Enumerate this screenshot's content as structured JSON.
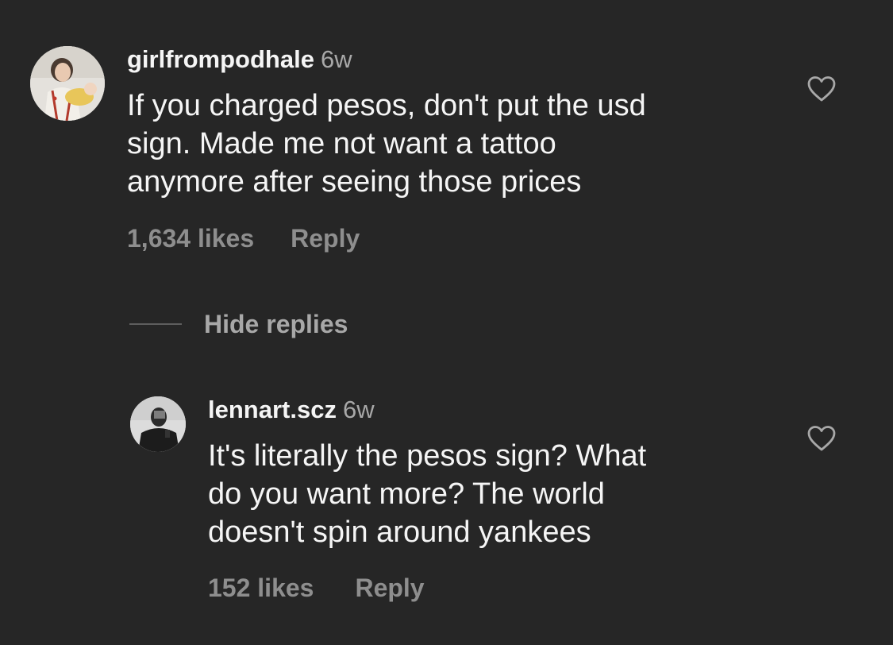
{
  "comments": [
    {
      "username": "girlfrompodhale",
      "time": "6w",
      "text": "If you charged pesos, don't put the usd\nsign.  Made me not want a tattoo\nanymore after seeing those prices",
      "likes": "1,634 likes",
      "reply_label": "Reply",
      "avatar_icon": "profile-photo-mother-with-baby",
      "like_icon": "heart-outline-icon"
    }
  ],
  "replies_toggle": {
    "label": "Hide replies"
  },
  "replies": [
    {
      "username": "lennart.scz",
      "time": "6w",
      "text": "It's literally the pesos sign? What\ndo you want more? The world\ndoesn't spin around yankees",
      "likes": "152 likes",
      "reply_label": "Reply",
      "avatar_icon": "profile-photo-mirror-selfie",
      "like_icon": "heart-outline-icon"
    }
  ],
  "colors": {
    "background": "#262626",
    "primary_text": "#f5f5f5",
    "secondary_text": "#8e8e8e"
  }
}
